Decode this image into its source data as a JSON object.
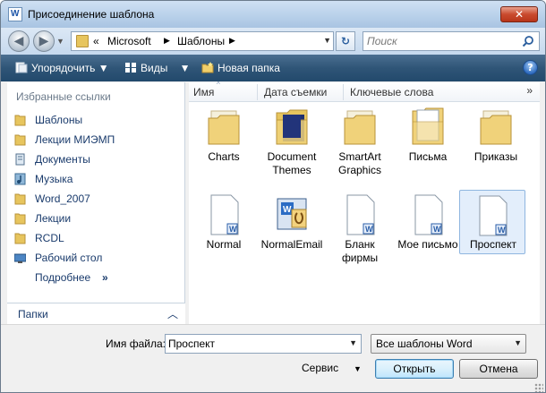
{
  "window": {
    "title": "Присоединение шаблона",
    "close_glyph": "✕"
  },
  "nav": {
    "back_glyph": "◀",
    "forward_glyph": "▶",
    "refresh_glyph": "↻"
  },
  "breadcrumb": {
    "prefix": "«",
    "items": [
      "Microsoft",
      "Шаблоны"
    ]
  },
  "search": {
    "placeholder": "Поиск",
    "value": ""
  },
  "toolbar": {
    "organize": "Упорядочить",
    "views": "Виды",
    "new_folder": "Новая папка",
    "help": "?"
  },
  "favorites": {
    "heading": "Избранные ссылки",
    "items": [
      {
        "label": "Шаблоны",
        "icon": "folder-icon"
      },
      {
        "label": "Лекции МИЭМП",
        "icon": "folder-icon"
      },
      {
        "label": "Документы",
        "icon": "documents-icon"
      },
      {
        "label": "Музыка",
        "icon": "music-icon"
      },
      {
        "label": "Word_2007",
        "icon": "folder-icon"
      },
      {
        "label": "Лекции",
        "icon": "folder-icon"
      },
      {
        "label": "RCDL",
        "icon": "folder-icon"
      },
      {
        "label": "Рабочий стол",
        "icon": "desktop-icon"
      }
    ],
    "more": "Подробнее",
    "more_glyph": "»"
  },
  "folders_bar": {
    "label": "Папки",
    "toggle_glyph": "^"
  },
  "columns": [
    "Имя",
    "Дата съемки",
    "Ключевые слова"
  ],
  "columns_more": "»",
  "files": [
    {
      "name": "Charts",
      "type": "folder"
    },
    {
      "name": "Document Themes",
      "type": "folder-dark"
    },
    {
      "name": "SmartArt Graphics",
      "type": "folder"
    },
    {
      "name": "Письма",
      "type": "folder-paper"
    },
    {
      "name": "Приказы",
      "type": "folder"
    },
    {
      "name": "Normal",
      "type": "template"
    },
    {
      "name": "NormalEmail",
      "type": "email-template"
    },
    {
      "name": "Бланк фирмы",
      "type": "template"
    },
    {
      "name": "Мое письмо",
      "type": "template"
    },
    {
      "name": "Проспект",
      "type": "template",
      "selected": true
    }
  ],
  "bottom": {
    "filename_label": "Имя файла:",
    "filename_value": "Проспект",
    "filter_value": "Все шаблоны Word",
    "service_label": "Сервис",
    "open_label": "Открыть",
    "cancel_label": "Отмена"
  },
  "colors": {
    "accent": "#2f5577",
    "selection": "#e3eefb",
    "folder": "#e7c55e"
  }
}
